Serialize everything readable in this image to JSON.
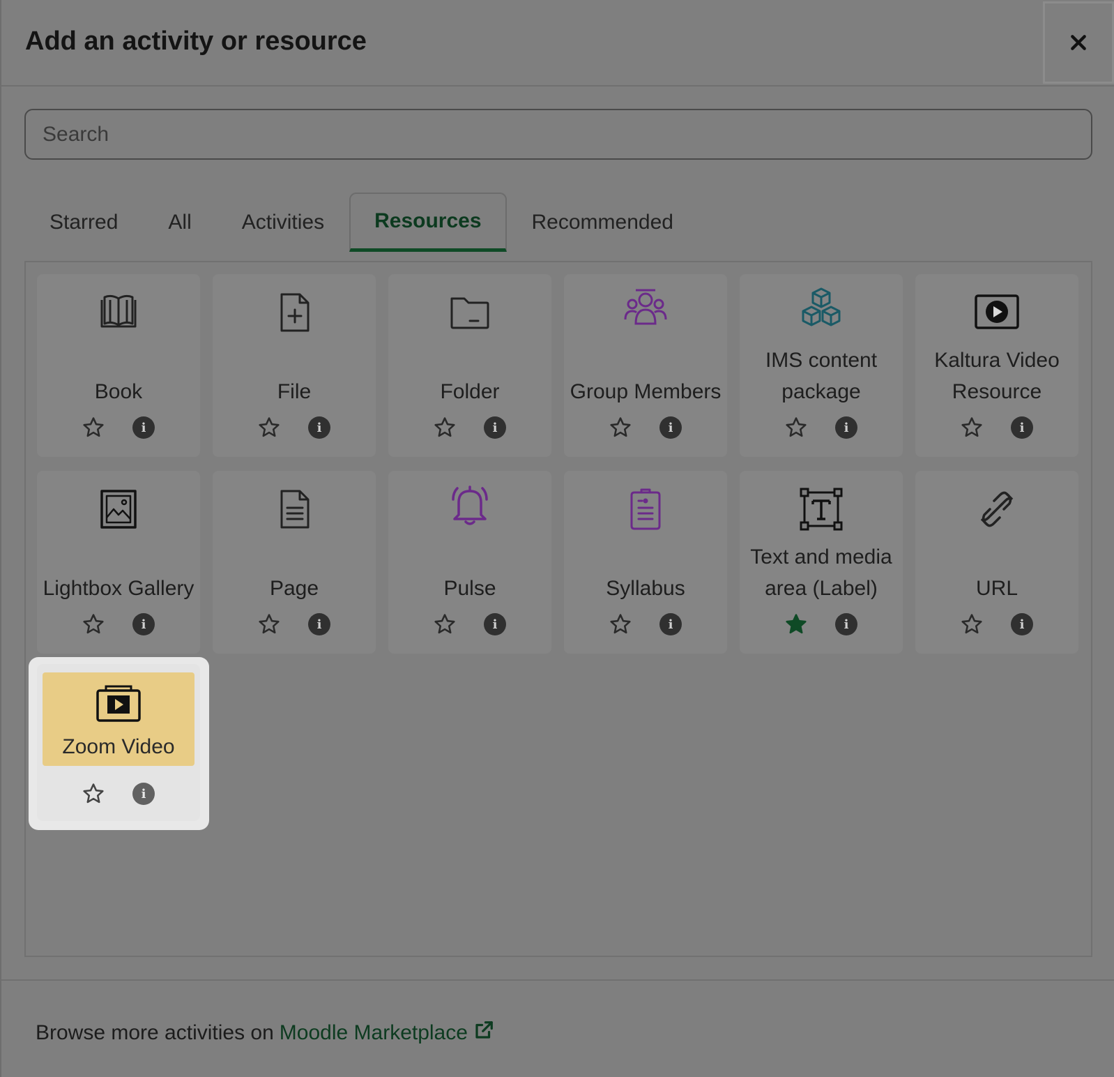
{
  "dialog": {
    "title": "Add an activity or resource",
    "close_label": "×"
  },
  "search": {
    "placeholder": "Search",
    "value": ""
  },
  "tabs": [
    {
      "label": "Starred",
      "active": false
    },
    {
      "label": "All",
      "active": false
    },
    {
      "label": "Activities",
      "active": false
    },
    {
      "label": "Resources",
      "active": true
    },
    {
      "label": "Recommended",
      "active": false
    }
  ],
  "tiles": [
    {
      "name": "Book",
      "icon": "book-icon",
      "starred": false
    },
    {
      "name": "File",
      "icon": "file-plus-icon",
      "starred": false
    },
    {
      "name": "Folder",
      "icon": "folder-icon",
      "starred": false
    },
    {
      "name": "Group Members",
      "icon": "group-members-icon",
      "starred": false
    },
    {
      "name": "IMS content package",
      "icon": "cubes-icon",
      "starred": false
    },
    {
      "name": "Kaltura Video Resource",
      "icon": "video-play-icon",
      "starred": false
    },
    {
      "name": "Lightbox Gallery",
      "icon": "image-gallery-icon",
      "starred": false
    },
    {
      "name": "Page",
      "icon": "page-icon",
      "starred": false
    },
    {
      "name": "Pulse",
      "icon": "bell-icon",
      "starred": false
    },
    {
      "name": "Syllabus",
      "icon": "syllabus-icon",
      "starred": false
    },
    {
      "name": "Text and media area (Label)",
      "icon": "text-box-icon",
      "starred": true
    },
    {
      "name": "URL",
      "icon": "link-icon",
      "starred": false
    },
    {
      "name": "Zoom Video",
      "icon": "zoom-video-icon",
      "starred": false
    }
  ],
  "footer": {
    "prefix": "Browse more activities on",
    "link_label": "Moodle Marketplace"
  },
  "colors": {
    "accent": "#0f4a26",
    "purple_icon": "#6b2a8a",
    "teal_icon": "#1a5a66",
    "highlight": "#e8cc86"
  }
}
